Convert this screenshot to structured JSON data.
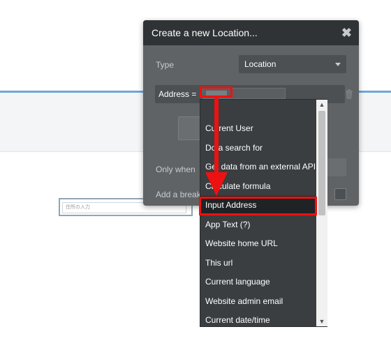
{
  "background": {
    "text_input_placeholder": "住所の入力"
  },
  "panel": {
    "title": "Create a new Location...",
    "close_icon": "close-x-icon",
    "type_label": "Type",
    "type_value": "Location",
    "field_label": "Address =",
    "only_when_label": "Only when",
    "breakpoint_label": "Add a breako",
    "trash_icon": "trash-icon"
  },
  "dropdown": {
    "items": [
      "Current User",
      "Do a search for",
      "Get data from an external API",
      "Calculate formula",
      "Input Address",
      "App Text (?)",
      "Website home URL",
      "This url",
      "Current language",
      "Website admin email",
      "Current date/time"
    ],
    "selected_index": 4
  },
  "annotations": {
    "highlight_color": "#ee1111"
  }
}
